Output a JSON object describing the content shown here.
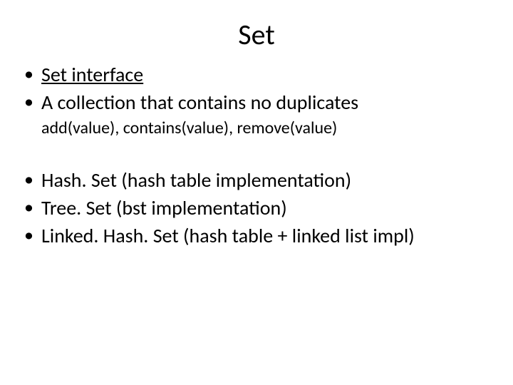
{
  "title": "Set",
  "bullets": {
    "b1_link": "Set interface",
    "b2": "A collection that contains no duplicates",
    "sub1": "add(value), contains(value), remove(value)",
    "b3": "Hash. Set (hash table implementation)",
    "b4": "Tree. Set (bst implementation)",
    "b5": "Linked. Hash. Set (hash table + linked list impl)"
  }
}
